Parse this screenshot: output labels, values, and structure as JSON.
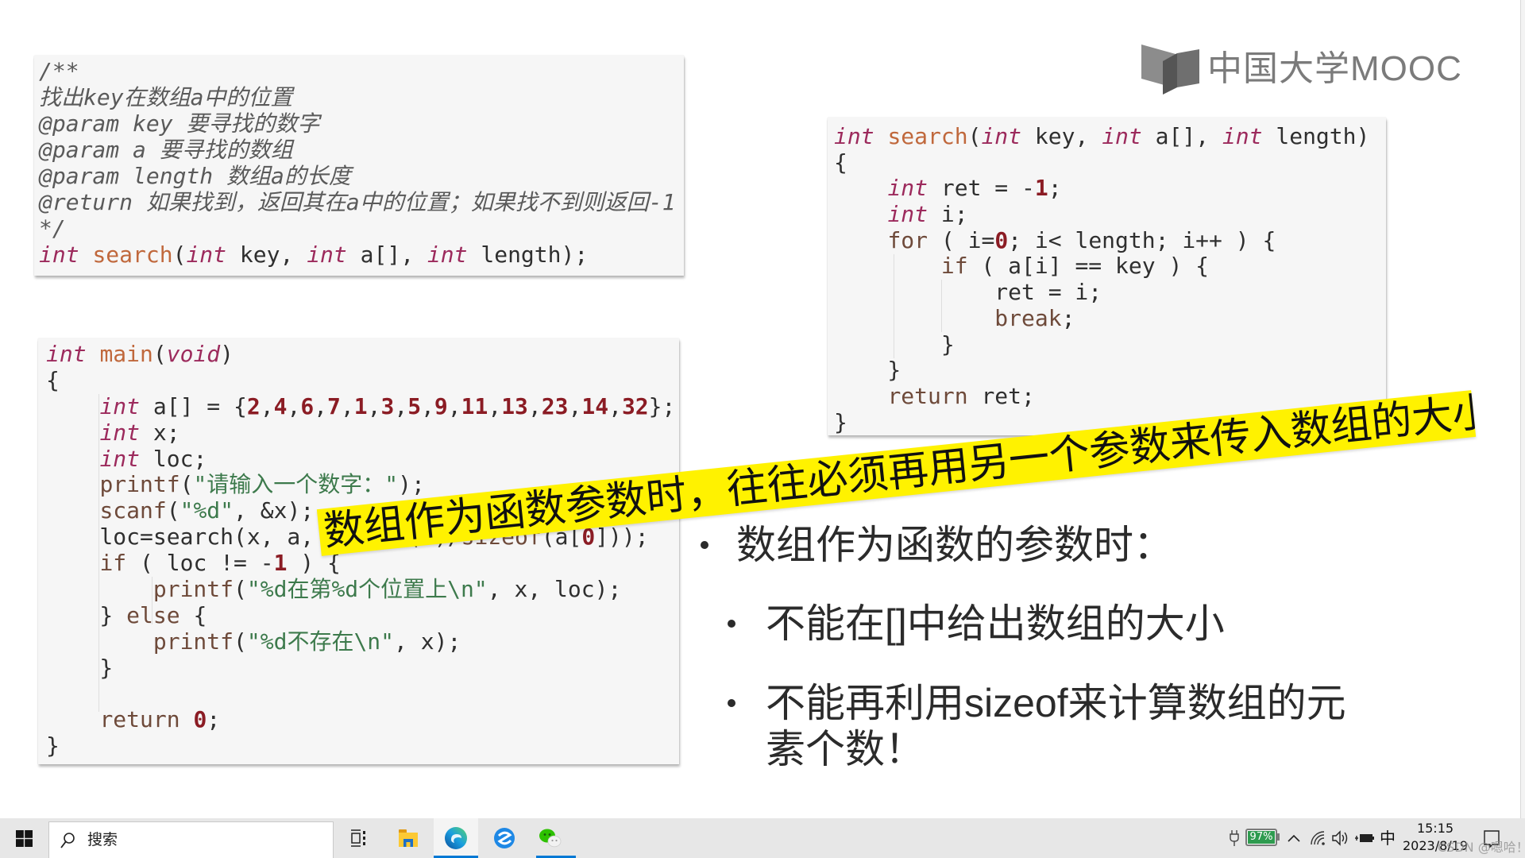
{
  "colors": {
    "banner": "#fff200",
    "code_bg": "#f6f6f6",
    "type": "#9c2a5c",
    "function": "#c0683c",
    "keyword": "#6e4a3a",
    "number": "#8b1c24",
    "string": "#3d7a4c",
    "comment": "#5a5a5a",
    "plain": "#2f2f2f",
    "logo": "#7b7b7b",
    "taskbar_accent": "#0078d4",
    "battery": "#2e9b4f"
  },
  "slide": {
    "logo": {
      "text": "中国大学MOOC",
      "icon": "book-icon"
    },
    "code_boxes": {
      "doc_comment": {
        "lines": [
          [
            [
              "/**",
              "com"
            ]
          ],
          [
            [
              "找出key在数组a中的位置",
              "com"
            ]
          ],
          [
            [
              "@param key 要寻找的数字",
              "com"
            ]
          ],
          [
            [
              "@param a 要寻找的数组",
              "com"
            ]
          ],
          [
            [
              "@param length 数组a的长度",
              "com"
            ]
          ],
          [
            [
              "@return 如果找到，返回其在a中的位置；如果找不到则返回-1",
              "com"
            ]
          ],
          [
            [
              "*/",
              "com"
            ]
          ],
          [
            [
              "int",
              "type"
            ],
            [
              " ",
              "p"
            ],
            [
              "search",
              "fn"
            ],
            [
              "(",
              "p"
            ],
            [
              "int",
              "type"
            ],
            [
              " key, ",
              "p"
            ],
            [
              "int",
              "type"
            ],
            [
              " a[], ",
              "p"
            ],
            [
              "int",
              "type"
            ],
            [
              " length);",
              "p"
            ]
          ]
        ]
      },
      "search_impl": {
        "lines": [
          [
            [
              "int",
              "type"
            ],
            [
              " ",
              "p"
            ],
            [
              "search",
              "fn"
            ],
            [
              "(",
              "p"
            ],
            [
              "int",
              "type"
            ],
            [
              " key, ",
              "p"
            ],
            [
              "int",
              "type"
            ],
            [
              " a[], ",
              "p"
            ],
            [
              "int",
              "type"
            ],
            [
              " length)",
              "p"
            ]
          ],
          [
            [
              "{",
              "p"
            ]
          ],
          [
            [
              "    ",
              "p"
            ],
            [
              "int",
              "type"
            ],
            [
              " ret = -",
              "p"
            ],
            [
              "1",
              "num"
            ],
            [
              ";",
              "p"
            ]
          ],
          [
            [
              "    ",
              "p"
            ],
            [
              "int",
              "type"
            ],
            [
              " i;",
              "p"
            ]
          ],
          [
            [
              "    ",
              "p"
            ],
            [
              "for",
              "kw"
            ],
            [
              " ( i=",
              "p"
            ],
            [
              "0",
              "num"
            ],
            [
              "; i< length; i++ ) {",
              "p"
            ]
          ],
          [
            [
              "        ",
              "p"
            ],
            [
              "if",
              "kw"
            ],
            [
              " ( a[i] == key ) {",
              "p"
            ]
          ],
          [
            [
              "            ret = i;",
              "p"
            ]
          ],
          [
            [
              "            ",
              "p"
            ],
            [
              "break",
              "kw"
            ],
            [
              ";",
              "p"
            ]
          ],
          [
            [
              "        }",
              "p"
            ]
          ],
          [
            [
              "    }",
              "p"
            ]
          ],
          [
            [
              "    ",
              "p"
            ],
            [
              "return",
              "kw"
            ],
            [
              " ret;",
              "p"
            ]
          ],
          [
            [
              "}",
              "p"
            ]
          ]
        ]
      },
      "main_func": {
        "lines": [
          [
            [
              "int",
              "type"
            ],
            [
              " ",
              "p"
            ],
            [
              "main",
              "fn"
            ],
            [
              "(",
              "p"
            ],
            [
              "void",
              "type"
            ],
            [
              ")",
              "p"
            ]
          ],
          [
            [
              "{",
              "p"
            ]
          ],
          [
            [
              "    ",
              "p"
            ],
            [
              "int",
              "type"
            ],
            [
              " a[] = {",
              "p"
            ],
            [
              "2",
              "num"
            ],
            [
              ",",
              "p"
            ],
            [
              "4",
              "num"
            ],
            [
              ",",
              "p"
            ],
            [
              "6",
              "num"
            ],
            [
              ",",
              "p"
            ],
            [
              "7",
              "num"
            ],
            [
              ",",
              "p"
            ],
            [
              "1",
              "num"
            ],
            [
              ",",
              "p"
            ],
            [
              "3",
              "num"
            ],
            [
              ",",
              "p"
            ],
            [
              "5",
              "num"
            ],
            [
              ",",
              "p"
            ],
            [
              "9",
              "num"
            ],
            [
              ",",
              "p"
            ],
            [
              "11",
              "num"
            ],
            [
              ",",
              "p"
            ],
            [
              "13",
              "num"
            ],
            [
              ",",
              "p"
            ],
            [
              "23",
              "num"
            ],
            [
              ",",
              "p"
            ],
            [
              "14",
              "num"
            ],
            [
              ",",
              "p"
            ],
            [
              "32",
              "num"
            ],
            [
              "};",
              "p"
            ]
          ],
          [
            [
              "    ",
              "p"
            ],
            [
              "int",
              "type"
            ],
            [
              " x;",
              "p"
            ]
          ],
          [
            [
              "    ",
              "p"
            ],
            [
              "int",
              "type"
            ],
            [
              " loc;",
              "p"
            ]
          ],
          [
            [
              "    ",
              "p"
            ],
            [
              "printf",
              "kw"
            ],
            [
              "(",
              "p"
            ],
            [
              "\"请输入一个数字：\"",
              "str"
            ],
            [
              ");",
              "p"
            ]
          ],
          [
            [
              "    ",
              "p"
            ],
            [
              "scanf",
              "kw"
            ],
            [
              "(",
              "p"
            ],
            [
              "\"%d\"",
              "str"
            ],
            [
              ", &x);",
              "p"
            ]
          ],
          [
            [
              "    loc=search(x, a, ",
              "p"
            ],
            [
              "sizeof",
              "kw"
            ],
            [
              "(a)/",
              "p"
            ],
            [
              "sizeof",
              "kw"
            ],
            [
              "(a[",
              "p"
            ],
            [
              "0",
              "num"
            ],
            [
              "]));",
              "p"
            ]
          ],
          [
            [
              "    ",
              "p"
            ],
            [
              "if",
              "kw"
            ],
            [
              " ( loc != -",
              "p"
            ],
            [
              "1",
              "num"
            ],
            [
              " ) {",
              "p"
            ]
          ],
          [
            [
              "        ",
              "p"
            ],
            [
              "printf",
              "kw"
            ],
            [
              "(",
              "p"
            ],
            [
              "\"%d在第%d个位置上\\n\"",
              "str"
            ],
            [
              ", x, loc);",
              "p"
            ]
          ],
          [
            [
              "    } ",
              "p"
            ],
            [
              "else",
              "kw"
            ],
            [
              " {",
              "p"
            ]
          ],
          [
            [
              "        ",
              "p"
            ],
            [
              "printf",
              "kw"
            ],
            [
              "(",
              "p"
            ],
            [
              "\"%d不存在\\n\"",
              "str"
            ],
            [
              ", x);",
              "p"
            ]
          ],
          [
            [
              "    }",
              "p"
            ]
          ],
          [],
          [
            [
              "    ",
              "p"
            ],
            [
              "return",
              "kw"
            ],
            [
              " ",
              "p"
            ],
            [
              "0",
              "num"
            ],
            [
              ";",
              "p"
            ]
          ],
          [
            [
              "}",
              "p"
            ]
          ]
        ]
      }
    },
    "banner": {
      "text": "数组作为函数参数时，往往必须再用另一个参数来传入数组的大小"
    },
    "bullets": {
      "main": "数组作为函数的参数时：",
      "subs": [
        "不能在[]中给出数组的大小",
        "不能再利用sizeof来计算数组的元素个数！"
      ]
    }
  },
  "taskbar": {
    "start_icon": "windows-logo-icon",
    "search_placeholder": "搜索",
    "pinned": [
      {
        "icon": "task-view-icon",
        "active": false
      },
      {
        "icon": "file-explorer-icon",
        "active": false
      },
      {
        "icon": "edge-icon",
        "active": true
      },
      {
        "icon": "browser-icon",
        "active": false
      },
      {
        "icon": "wechat-icon",
        "active": false,
        "running": true
      }
    ],
    "tray": {
      "battery_percent": "97%",
      "ime": "中",
      "time": "15:15",
      "date": "2023/8/19"
    },
    "watermark": "CSDN @嗯哈！"
  }
}
